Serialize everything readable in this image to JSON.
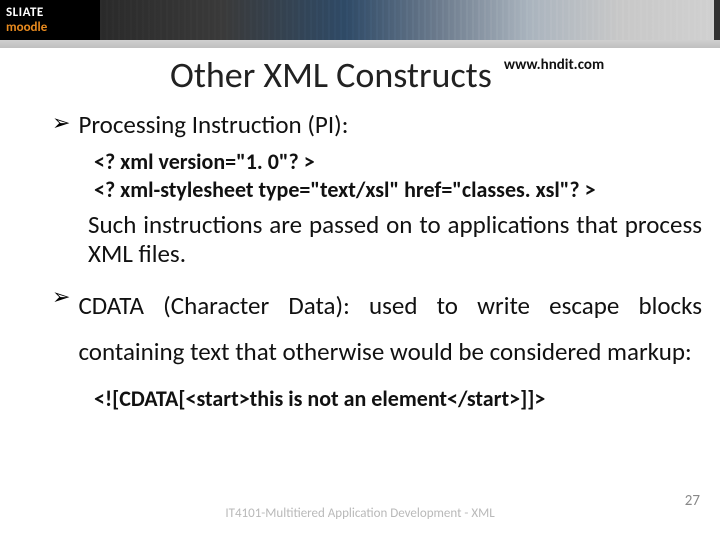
{
  "banner": {
    "logo_line1": "SLIATE",
    "logo_line2": "moodle"
  },
  "title": "Other XML Constructs",
  "url": "www.hndit.com",
  "bullet_pi": "Processing Instruction (PI):",
  "pi_code": {
    "line1": "<? xml version=\"1. 0\"? >",
    "line2": "<? xml-stylesheet type=\"text/xsl\" href=\"classes. xsl\"? >"
  },
  "pi_desc": "Such instructions are passed on to applications that process XML files.",
  "bullet_cdata": "CDATA (Character Data): used to write escape blocks containing text that otherwise would be considered markup:",
  "cdata_example": "<![CDATA[<start>this is not an element</start>]]>",
  "footer": {
    "course": "IT4101-Multitiered Application Development - XML",
    "page": "27"
  }
}
